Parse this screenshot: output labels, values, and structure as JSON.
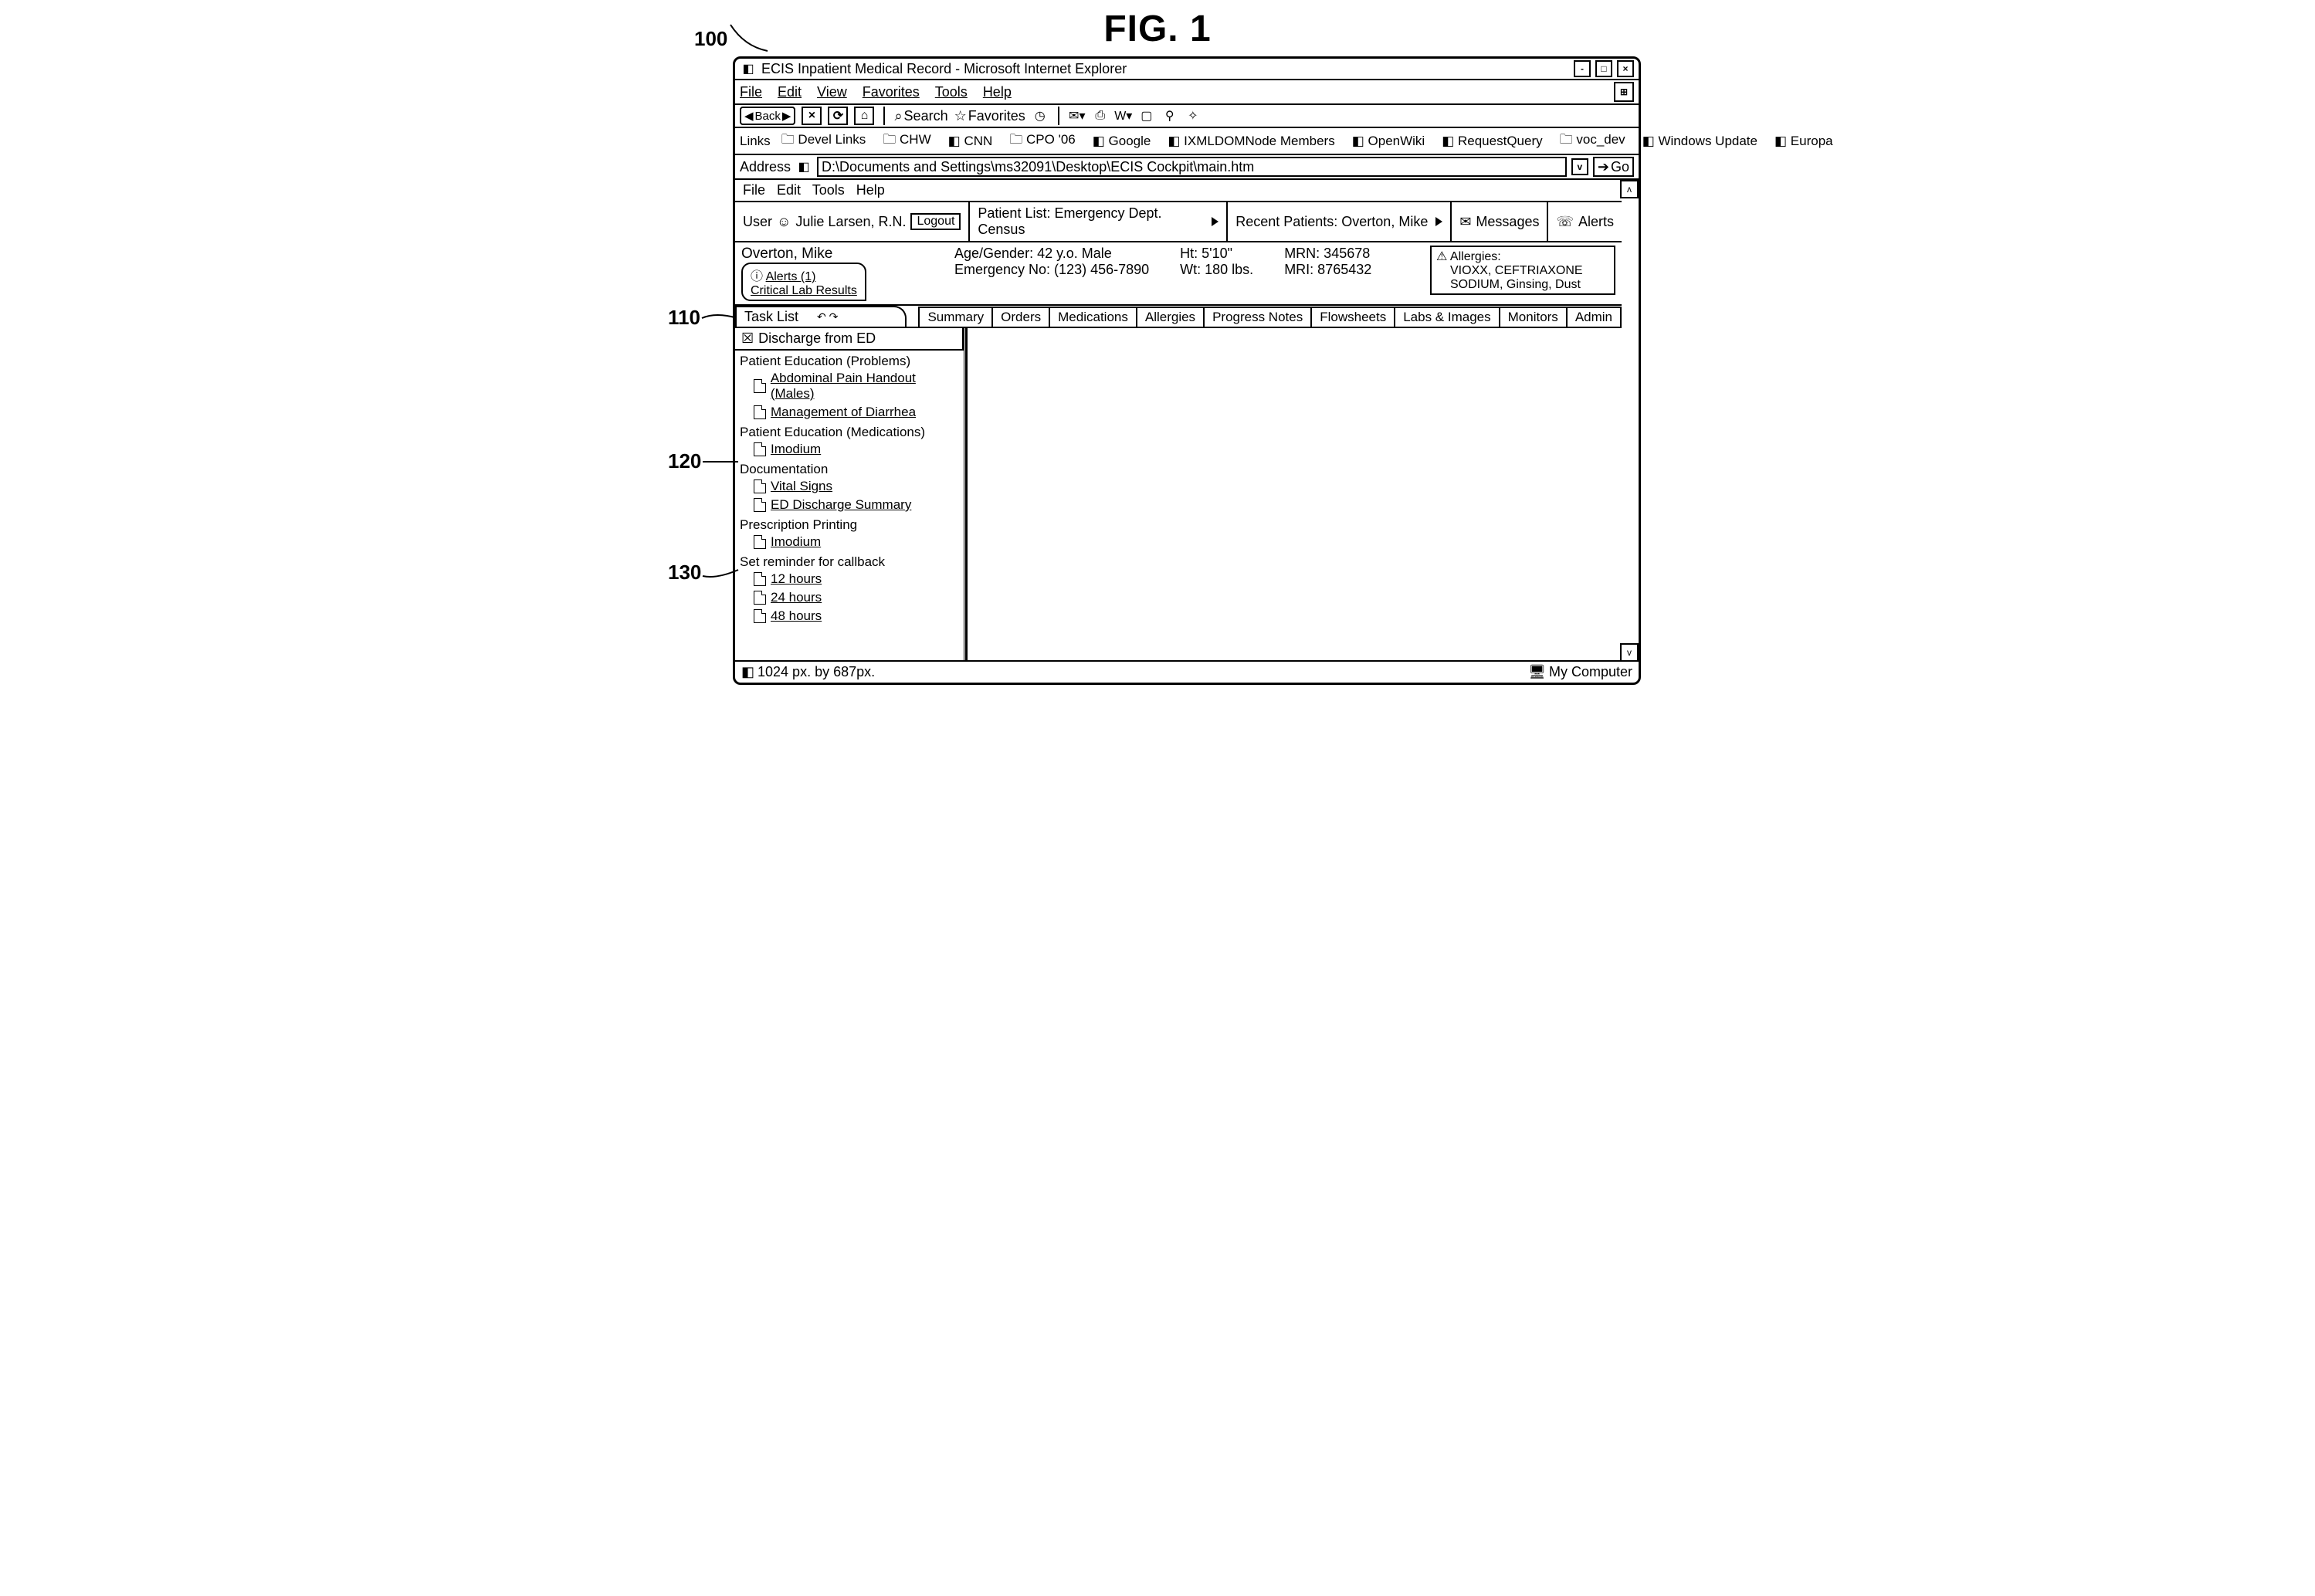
{
  "figure": {
    "label": "FIG. 1",
    "ref": "100",
    "callouts": [
      "110",
      "120",
      "130"
    ]
  },
  "window": {
    "title": "ECIS Inpatient Medical Record - Microsoft Internet Explorer",
    "menus": [
      "File",
      "Edit",
      "View",
      "Favorites",
      "Tools",
      "Help"
    ]
  },
  "toolbar": {
    "back": "Back",
    "search": "Search",
    "favorites": "Favorites"
  },
  "linksbar": {
    "prefix": "Links",
    "items": [
      "Devel Links",
      "CHW",
      "CNN",
      "CPO '06",
      "Google",
      "IXMLDOMNode Members",
      "OpenWiki",
      "RequestQuery",
      "voc_dev",
      "Windows Update",
      "Europa"
    ]
  },
  "address": {
    "label": "Address",
    "value": "D:\\Documents and Settings\\ms32091\\Desktop\\ECIS Cockpit\\main.htm",
    "go": "Go"
  },
  "app": {
    "menus": [
      "File",
      "Edit",
      "Tools",
      "Help"
    ],
    "user_label": "User",
    "user_name": "Julie Larsen, R.N.",
    "logout": "Logout",
    "patient_list": "Patient List: Emergency Dept. Census",
    "recent": "Recent Patients: Overton, Mike",
    "messages": "Messages",
    "alerts": "Alerts"
  },
  "patient": {
    "name": "Overton, Mike",
    "alerts_label": "Alerts (1)",
    "alerts_detail": "Critical Lab Results",
    "age_gender": "Age/Gender: 42 y.o. Male",
    "emergency": "Emergency No: (123) 456-7890",
    "ht": "Ht: 5'10\"",
    "wt": "Wt: 180 lbs.",
    "mrn": "MRN: 345678",
    "mri": "MRI: 8765432",
    "allergies_label": "Allergies:",
    "allergies": "VIOXX, CEFTRIAXONE SODIUM, Ginsing, Dust"
  },
  "tabs": {
    "tasklist": "Task List",
    "items": [
      "Summary",
      "Orders",
      "Medications",
      "Allergies",
      "Progress Notes",
      "Flowsheets",
      "Labs & Images",
      "Monitors",
      "Admin"
    ]
  },
  "tasklist": {
    "header": "Discharge from ED",
    "groups": [
      {
        "title": "Patient Education (Problems)",
        "items": [
          "Abdominal Pain Handout (Males)",
          "Management of Diarrhea"
        ]
      },
      {
        "title": "Patient Education (Medications)",
        "items": [
          "Imodium"
        ]
      },
      {
        "title": "Documentation",
        "items": [
          "Vital Signs",
          "ED Discharge Summary"
        ]
      },
      {
        "title": "Prescription Printing",
        "items": [
          "Imodium"
        ]
      },
      {
        "title": "Set reminder for callback",
        "items": [
          "12 hours",
          "24 hours",
          "48 hours"
        ]
      }
    ]
  },
  "status": {
    "left": "1024 px. by 687px.",
    "right": "My Computer"
  }
}
